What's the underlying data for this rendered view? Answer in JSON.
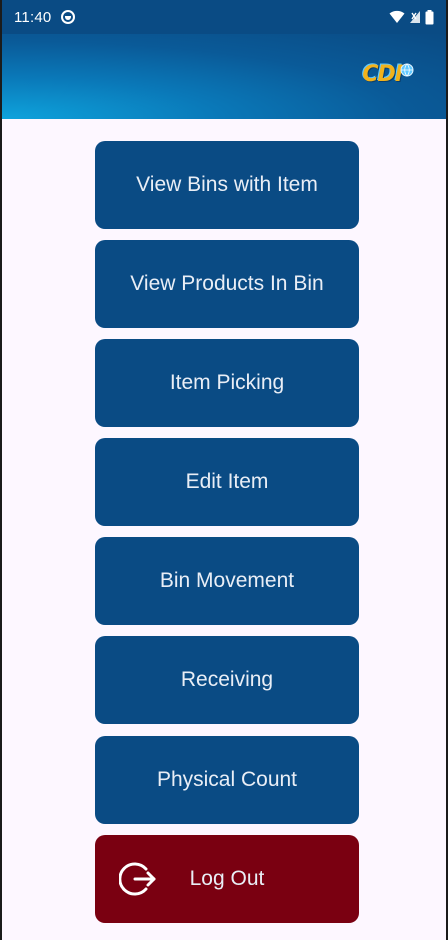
{
  "status_bar": {
    "time": "11:40"
  },
  "header": {
    "logo_text": "CDI"
  },
  "menu": [
    {
      "label": "View Bins with Item"
    },
    {
      "label": "View Products In Bin"
    },
    {
      "label": "Item Picking"
    },
    {
      "label": "Edit Item"
    },
    {
      "label": "Bin Movement"
    },
    {
      "label": "Receiving"
    },
    {
      "label": "Physical Count"
    }
  ],
  "logout": {
    "label": "Log Out",
    "icon": "logout-icon"
  },
  "colors": {
    "primary": "#0a4b84",
    "logout": "#7a0011",
    "background": "#fdf7ff"
  }
}
